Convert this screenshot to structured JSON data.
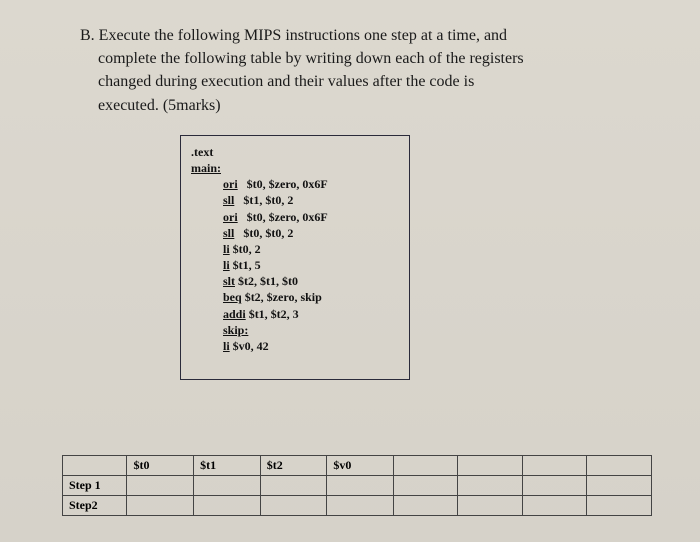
{
  "question": {
    "label": "B.",
    "line1": "B. Execute the following MIPS instructions one step at a time, and",
    "line2": "complete the following table by writing down each of the registers",
    "line3": "changed during execution and their values after the code is",
    "line4": "executed. (5marks)"
  },
  "code": {
    "l1": ".text",
    "l2": "main:",
    "l3": "ori   $t0, $zero, 0x6F",
    "l4": "sll   $t1, $t0, 2",
    "l5": "ori   $t0, $zero, 0x6F",
    "l6": "sll   $t0, $t0, 2",
    "l7": "li $t0, 2",
    "l8": "li $t1, 5",
    "l9": "slt $t2, $t1, $t0",
    "l10": "beq $t2, $zero, skip",
    "l11": "addi $t1, $t2, 3",
    "l12": "skip:",
    "l13": "li $v0, 42"
  },
  "table": {
    "headers": [
      "",
      "$t0",
      "$t1",
      "$t2",
      "$v0",
      "",
      "",
      "",
      ""
    ],
    "rows": [
      "Step 1",
      "Step2"
    ]
  }
}
